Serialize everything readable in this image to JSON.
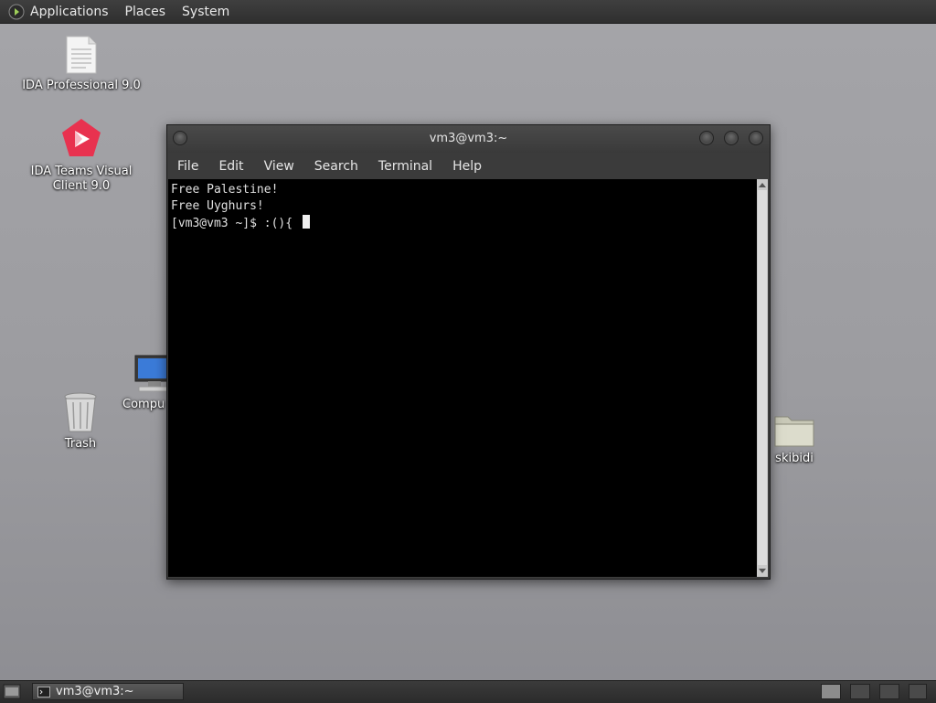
{
  "top_panel": {
    "menus": [
      "Applications",
      "Places",
      "System"
    ]
  },
  "desktop": {
    "icons": [
      {
        "label": "IDA Professional 9.0",
        "icon": "document-icon"
      },
      {
        "label": "IDA Teams Visual Client 9.0",
        "icon": "ida-teams-icon"
      },
      {
        "label": "Compu",
        "icon": "computer-icon"
      },
      {
        "label": "Trash",
        "icon": "trash-icon"
      },
      {
        "label": "skibidi",
        "icon": "folder-icon"
      }
    ]
  },
  "terminal": {
    "title": "vm3@vm3:~",
    "menu": [
      "File",
      "Edit",
      "View",
      "Search",
      "Terminal",
      "Help"
    ],
    "lines": [
      "Free Palestine!",
      "Free Uyghurs!"
    ],
    "prompt": "[vm3@vm3 ~]$ :(){ "
  },
  "bottom_panel": {
    "task_label": "vm3@vm3:~"
  }
}
